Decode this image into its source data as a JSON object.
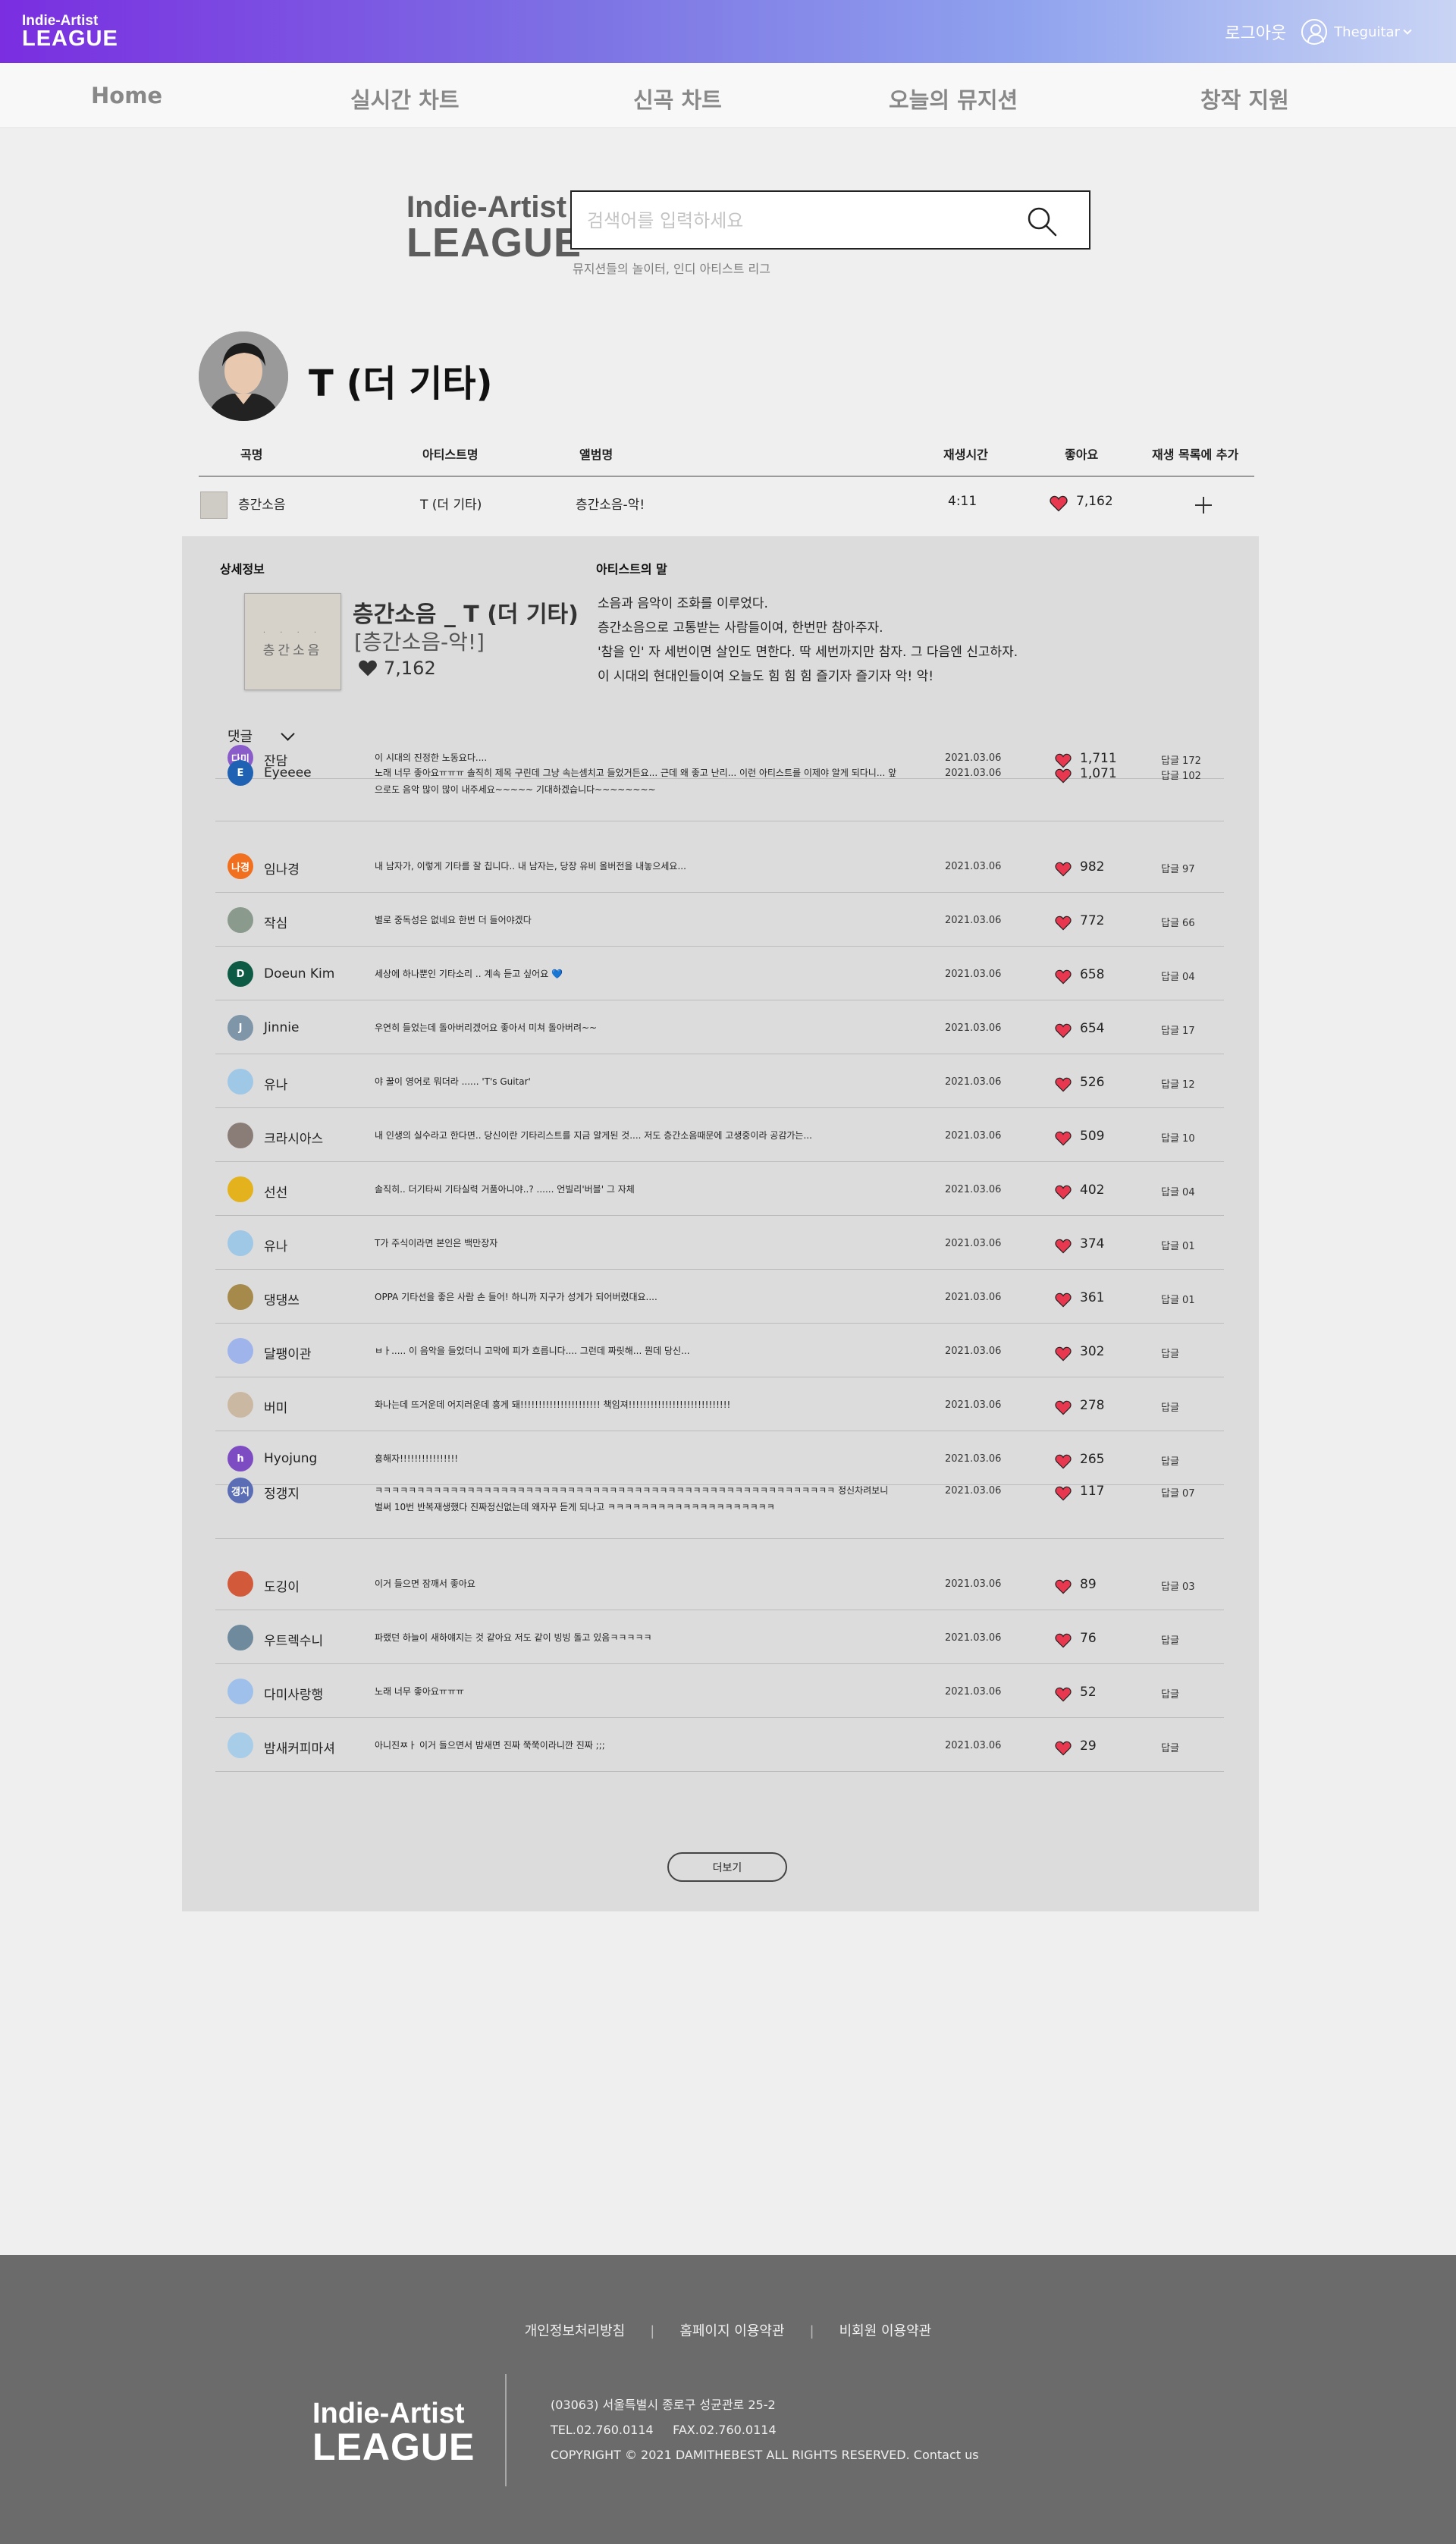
{
  "header": {
    "logo_line1": "Indie-Artist",
    "logo_line2": "LEAGUE",
    "logout": "로그아웃",
    "username": "Theguitar"
  },
  "nav": [
    "Home",
    "실시간 차트",
    "신곡 차트",
    "오늘의 뮤지션",
    "창작 지원"
  ],
  "search": {
    "brand_line1": "Indie-Artist",
    "brand_line2": "LEAGUE",
    "placeholder": "검색어를 입력하세요",
    "subtitle": "뮤지션들의 놀이터, 인디 아티스트 리그"
  },
  "artist": {
    "name": "T (더 기타)"
  },
  "table": {
    "headers": [
      "곡명",
      "아티스트명",
      "앨범명",
      "재생시간",
      "좋아요",
      "재생 목록에 추가"
    ],
    "row": {
      "title": "층간소음",
      "artist": "T (더 기타)",
      "album": "층간소음-악!",
      "duration": "4:11",
      "likes": "7,162"
    }
  },
  "detail": {
    "label_info": "상세정보",
    "label_artist_words": "아티스트의 말",
    "album_cover_text": "층간소음",
    "album_cover_dots": "· · · ·",
    "title": "층간소음 _ T (더 기타)",
    "subtitle": "[층간소음-악!]",
    "likes": "7,162",
    "artist_words": [
      "소음과 음악이 조화를 이루었다.",
      "층간소음으로 고통받는 사람들이여, 한번만 참아주자.",
      "'참을 인' 자 세번이면 살인도 면한다. 딱 세번까지만 참자. 그 다음엔 신고하자.",
      "이 시대의 현대인들이여 오늘도 힘 힘 힘 즐기자 즐기자 악! 악!"
    ],
    "comments_label": "댓글",
    "more": "더보기"
  },
  "accent_heart_color": "#e8384f",
  "comments": [
    {
      "name": "잔담",
      "avatar_text": "다미",
      "avatar_color": "#8a5cc9",
      "text": "이 시대의 진정한 노동요다....",
      "date": "2021.03.06",
      "likes": "1,711",
      "reply": "답글 172"
    },
    {
      "name": "Eyeeee",
      "avatar_text": "E",
      "avatar_color": "#1f62b3",
      "text": "노래 너무 좋아요ㅠㅠㅠ 솔직히 제목 구린데 그냥 속는셈치고 들었거든요... 근데 왜 좋고 난리... 이런 아티스트를 이제야 알게 되다니... 앞으로도 음악 많이 많이 내주세요~~~~~ 기대하겠습니다~~~~~~~~",
      "date": "2021.03.06",
      "likes": "1,071",
      "reply": "답글 102"
    },
    {
      "name": "임나경",
      "avatar_text": "나경",
      "avatar_color": "#f07020",
      "text": "내 남자가, 이렇게 기타를 잘 칩니다.. 내 남자는, 당장 유비 올버전을 내놓으세요...",
      "date": "2021.03.06",
      "likes": "982",
      "reply": "답글 97"
    },
    {
      "name": "작심",
      "avatar_text": "",
      "avatar_color": "#8a9a8c",
      "text": "별로 중독성은 없네요 한번 더 들어야겠다",
      "date": "2021.03.06",
      "likes": "772",
      "reply": "답글 66"
    },
    {
      "name": "Doeun Kim",
      "avatar_text": "D",
      "avatar_color": "#0d5a45",
      "text": "세상에 하나뿐인 기타소리 .. 계속 듣고 싶어요 💙",
      "date": "2021.03.06",
      "likes": "658",
      "reply": "답글 04"
    },
    {
      "name": "Jinnie",
      "avatar_text": "J",
      "avatar_color": "#7f95a8",
      "text": "우연히 들었는데 돌아버리겠어요 좋아서 미쳐 돌아버려~~",
      "date": "2021.03.06",
      "likes": "654",
      "reply": "답글 17"
    },
    {
      "name": "유나",
      "avatar_text": "",
      "avatar_color": "#9fc7e6",
      "text": "야 꿀이 영어로 뭐더라     ......     'T's Guitar'",
      "date": "2021.03.06",
      "likes": "526",
      "reply": "답글 12"
    },
    {
      "name": "크라시아스",
      "avatar_text": "",
      "avatar_color": "#8a7c76",
      "text": "내 인생의 실수라고 한다면.. 당신이란 기타리스트를 지금 알게된 것.... 저도 층간소음때문에 고생중이라 공감가는...",
      "date": "2021.03.06",
      "likes": "509",
      "reply": "답글 10"
    },
    {
      "name": "선선",
      "avatar_text": "",
      "avatar_color": "#e3b21c",
      "text": "솔직히.. 더기타씨 기타실력 거품아니야..?       ......     언빌리'버블' 그 자체",
      "date": "2021.03.06",
      "likes": "402",
      "reply": "답글 04"
    },
    {
      "name": "유나",
      "avatar_text": "",
      "avatar_color": "#9fc7e6",
      "text": "T가 주식이라면 본인은 백만장자",
      "date": "2021.03.06",
      "likes": "374",
      "reply": "답글 01"
    },
    {
      "name": "댕댕쓰",
      "avatar_text": "",
      "avatar_color": "#a58a4c",
      "text": "OPPA 기타선을 좋은 사람 손 들어! 하니까 지구가 성게가 되어버렸대요....",
      "date": "2021.03.06",
      "likes": "361",
      "reply": "답글 01"
    },
    {
      "name": "달팽이관",
      "avatar_text": "",
      "avatar_color": "#9fb4ea",
      "text": "ㅂㅏ..... 이 음악을 들었더니 고막에 피가 흐릅니다.... 그런데 짜릿해... 뭔데 당신...",
      "date": "2021.03.06",
      "likes": "302",
      "reply": "답글"
    },
    {
      "name": "버미",
      "avatar_text": "",
      "avatar_color": "#cbb8a2",
      "text": "화나는데 뜨거운데 어지러운데 흥게 돼!!!!!!!!!!!!!!!!!!!!!! 책임져!!!!!!!!!!!!!!!!!!!!!!!!!!!!",
      "date": "2021.03.06",
      "likes": "278",
      "reply": "답글"
    },
    {
      "name": "Hyojung",
      "avatar_text": "h",
      "avatar_color": "#7d4cc2",
      "text": "흥해자!!!!!!!!!!!!!!!!",
      "date": "2021.03.06",
      "likes": "265",
      "reply": "답글"
    },
    {
      "name": "정갱지",
      "avatar_text": "갱지",
      "avatar_color": "#5a6db5",
      "text": "ㅋㅋㅋㅋㅋㅋㅋㅋㅋㅋㅋㅋㅋㅋㅋㅋㅋㅋㅋㅋㅋㅋㅋㅋㅋㅋㅋㅋㅋㅋㅋㅋㅋㅋㅋㅋㅋㅋㅋㅋㅋㅋㅋㅋㅋㅋㅋㅋㅋㅋㅋㅋㅋㅋㅋ 정신차려보니 벌써 10번 반복재생했다 진짜정신없는데 왜자꾸 듣게 되나고 ㅋㅋㅋㅋㅋㅋㅋㅋㅋㅋㅋㅋㅋㅋㅋㅋㅋㅋㅋㅋ",
      "date": "2021.03.06",
      "likes": "117",
      "reply": "답글 07"
    },
    {
      "name": "도깅이",
      "avatar_text": "",
      "avatar_color": "#d25a3a",
      "text": "이거 들으면 잠깨서 좋아요",
      "date": "2021.03.06",
      "likes": "89",
      "reply": "답글 03"
    },
    {
      "name": "우트렉수니",
      "avatar_text": "",
      "avatar_color": "#6f8a9c",
      "text": "파랬던 하늘이 새하얘지는 것 같아요 저도 같이 빙빙 돌고 있음ㅋㅋㅋㅋㅋ",
      "date": "2021.03.06",
      "likes": "76",
      "reply": "답글"
    },
    {
      "name": "다미사랑행",
      "avatar_text": "",
      "avatar_color": "#9fc0ea",
      "text": "노래 너무 좋아요ㅠㅠㅠ",
      "date": "2021.03.06",
      "likes": "52",
      "reply": "답글"
    },
    {
      "name": "밤새커피마셔",
      "avatar_text": "",
      "avatar_color": "#a7cde8",
      "text": "아니진ㅉㅏ 이거 들으면서 밤새면 진짜 쭉쭉이라니깐 진짜 ;;;",
      "date": "2021.03.06",
      "likes": "29",
      "reply": "답글"
    }
  ],
  "footer": {
    "links": [
      "개인정보처리방침",
      "홈페이지 이용약관",
      "비회원 이용약관"
    ],
    "separator": "|",
    "logo_line1": "Indie-Artist",
    "logo_line2": "LEAGUE",
    "address": "(03063) 서울특별시 종로구 성균관로 25-2",
    "tel": "TEL.02.760.0114     FAX.02.760.0114",
    "copyright": "COPYRIGHT © 2021 DAMITHEBEST ALL RIGHTS RESERVED. Contact us"
  }
}
